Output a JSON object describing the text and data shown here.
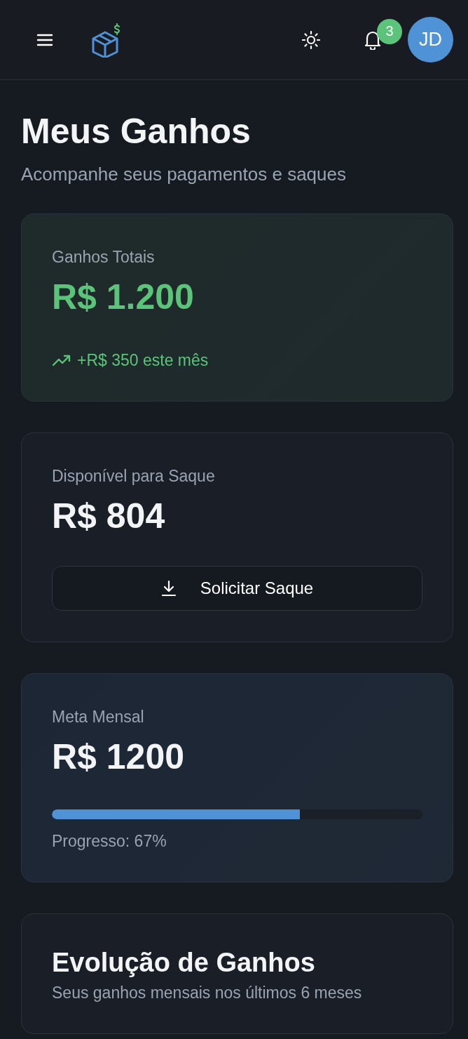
{
  "header": {
    "notifications": "3",
    "avatar": "JD"
  },
  "page": {
    "title": "Meus Ganhos",
    "subtitle": "Acompanhe seus pagamentos e saques"
  },
  "cards": [
    {
      "kind": "total",
      "label": "Ganhos Totais",
      "amount": "R$ 1.200",
      "trend": "+R$ 350 este mês"
    },
    {
      "kind": "available",
      "label": "Disponível para Saque",
      "amount": "R$ 804",
      "button": "Solicitar Saque"
    },
    {
      "kind": "goal",
      "label": "Meta Mensal",
      "amount": "R$ 1200",
      "level": 0.67,
      "progress": "Progresso: 67%"
    }
  ],
  "chart_card": {
    "title": "Evolução de Ganhos",
    "subtitle": "Seus ganhos mensais nos últimos 6 meses"
  }
}
